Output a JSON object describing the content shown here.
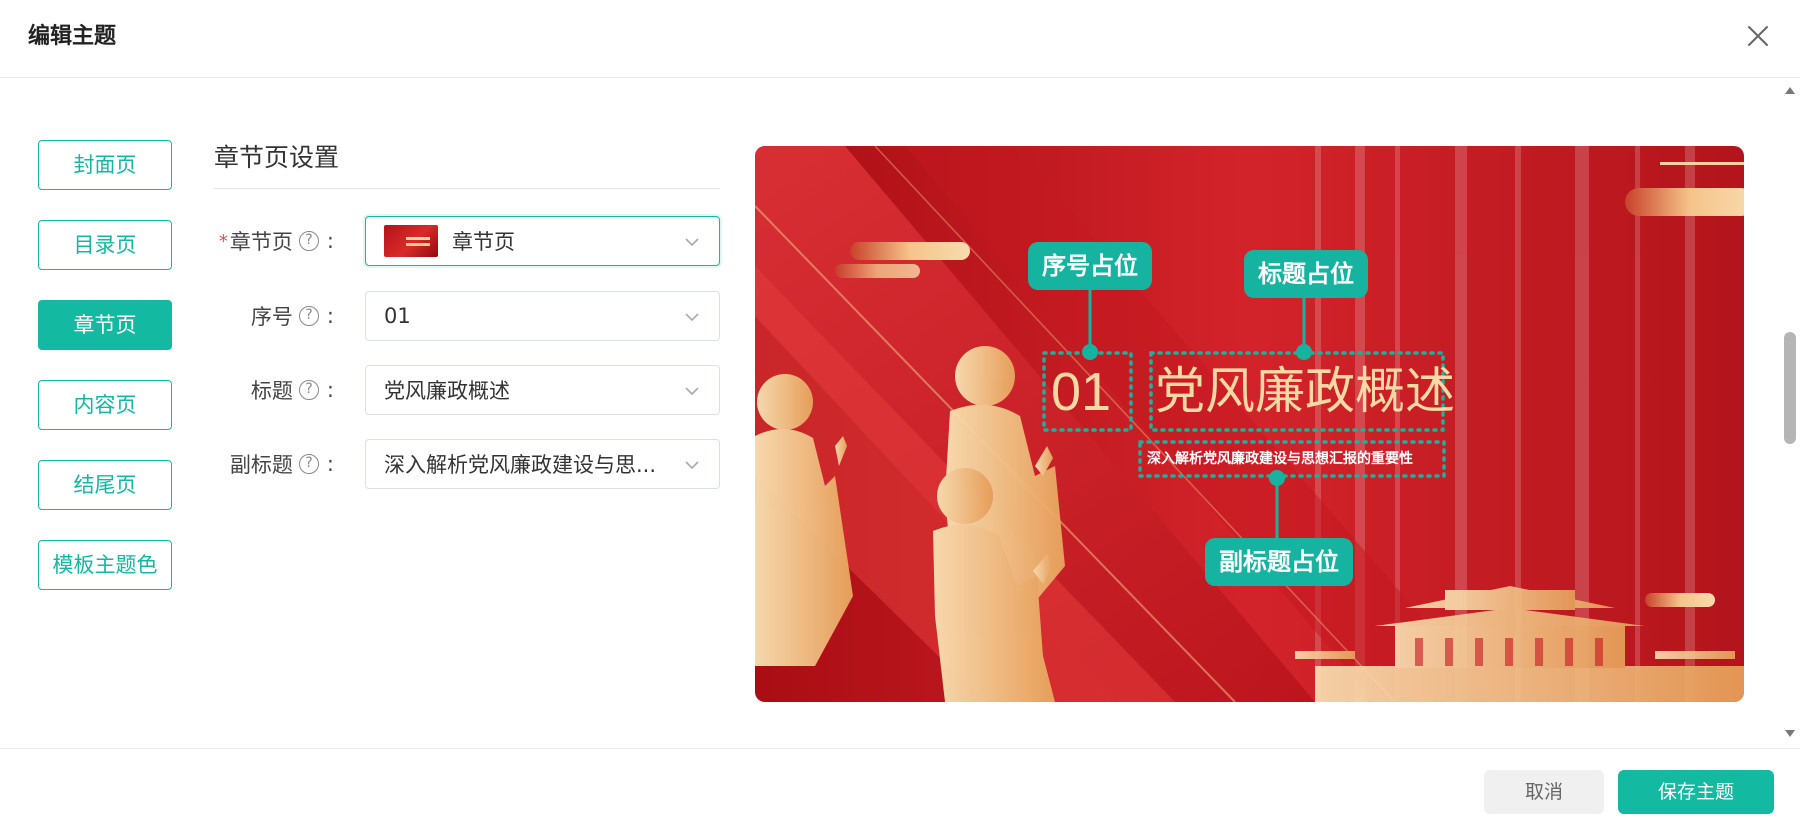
{
  "header": {
    "title": "编辑主题"
  },
  "nav": {
    "items": [
      {
        "label": "封面页"
      },
      {
        "label": "目录页"
      },
      {
        "label": "章节页"
      },
      {
        "label": "内容页"
      },
      {
        "label": "结尾页"
      },
      {
        "label": "模板主题色"
      }
    ],
    "active_index": 2
  },
  "settings": {
    "section_title": "章节页设置",
    "fields": {
      "chapter": {
        "label": "章节页",
        "required": true,
        "value": "章节页"
      },
      "number": {
        "label": "序号",
        "value": "01"
      },
      "title": {
        "label": "标题",
        "value": "党风廉政概述"
      },
      "subtitle": {
        "label": "副标题",
        "value": "深入解析党风廉政建设与思..."
      }
    },
    "colon": ":"
  },
  "preview": {
    "number_text": "01",
    "title_text": "党风廉政概述",
    "subtitle_text": "深入解析党风廉政建设与思想汇报的重要性",
    "callouts": {
      "number": "序号占位",
      "title": "标题占位",
      "subtitle": "副标题占位"
    }
  },
  "footer": {
    "cancel_label": "取消",
    "save_label": "保存主题"
  },
  "colors": {
    "accent": "#13b9a0",
    "required": "#e84a4a",
    "slide_red": "#c8161e",
    "slide_gold": "#f6d9a4"
  },
  "icons": {
    "close": "close-icon",
    "help": "question-circle-icon",
    "chevron": "chevron-down-icon"
  }
}
